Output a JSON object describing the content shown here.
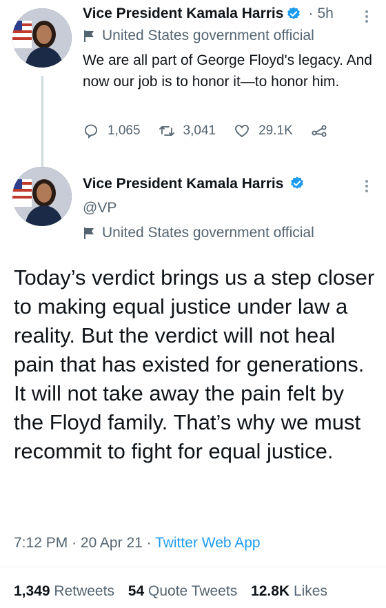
{
  "colors": {
    "verified": "#1d9bf0",
    "muted": "#536471",
    "link": "#1d9bf0"
  },
  "tweet1": {
    "author": "Vice President Kamala Harris",
    "time": "5h",
    "label": "United States government official",
    "text": "We are all part of George Floyd's legacy. And now our job is to honor it—to honor him.",
    "replies": "1,065",
    "retweets": "3,041",
    "likes": "29.1K"
  },
  "tweet2": {
    "author": "Vice President Kamala Harris",
    "handle": "@VP",
    "label": "United States government official",
    "text": "Today’s verdict brings us a step closer to making equal justice under law a reality. But the verdict will not heal pain that has existed for generations. It will not take away the pain felt by the Floyd family. That’s why we must recommit to fight for equal justice.",
    "time": "7:12 PM",
    "date": "20 Apr 21",
    "app": "Twitter Web App",
    "retweets_count": "1,349",
    "retweets_label": "Retweets",
    "quotes_count": "54",
    "quotes_label": "Quote Tweets",
    "likes_count": "12.8K",
    "likes_label": "Likes"
  }
}
